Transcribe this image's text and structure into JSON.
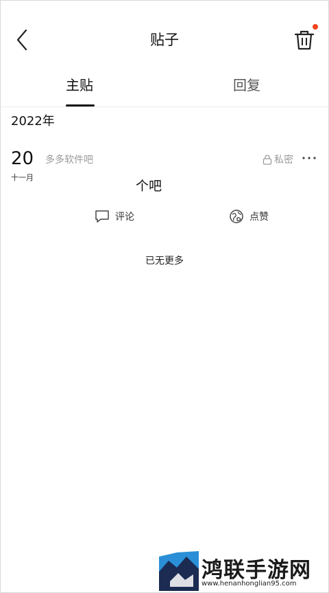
{
  "header": {
    "title": "贴子",
    "back_icon": "chevron-left-icon",
    "delete_icon": "trash-icon",
    "notification_dot_color": "#f0441c"
  },
  "tabs": [
    {
      "label": "主贴",
      "active": true
    },
    {
      "label": "回复",
      "active": false
    }
  ],
  "year_label": "2022年",
  "post": {
    "day": "20",
    "month": "十一月",
    "forum": "多多软件吧",
    "privacy": "私密",
    "privacy_icon": "lock-icon",
    "more_icon": "more-dots-icon",
    "content": "个吧",
    "comment_label": "评论",
    "comment_icon": "comment-icon",
    "like_label": "点赞",
    "like_icon": "like-icon"
  },
  "footer_text": "已无更多",
  "watermark": {
    "title": "鸿联手游网",
    "url": "www.henanhonglian95.com"
  }
}
